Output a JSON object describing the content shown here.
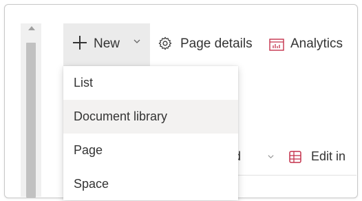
{
  "toolbar": {
    "new_label": "New",
    "page_details_label": "Page details",
    "analytics_label": "Analytics"
  },
  "new_menu": {
    "items": [
      {
        "label": "List"
      },
      {
        "label": "Document library"
      },
      {
        "label": "Page"
      },
      {
        "label": "Space"
      }
    ]
  },
  "background": {
    "upload_fragment": "ad",
    "edit_fragment": "Edit in"
  },
  "icons": {
    "new": "plus-icon",
    "new_caret": "chevron-down-icon",
    "page_details": "gear-icon",
    "analytics": "analytics-icon",
    "edit_in": "grid-icon"
  },
  "colors": {
    "text": "#333333",
    "new_button_bg": "#ebebeb",
    "menu_hover_bg": "#f3f2f1",
    "edit_icon": "#c4314b"
  }
}
